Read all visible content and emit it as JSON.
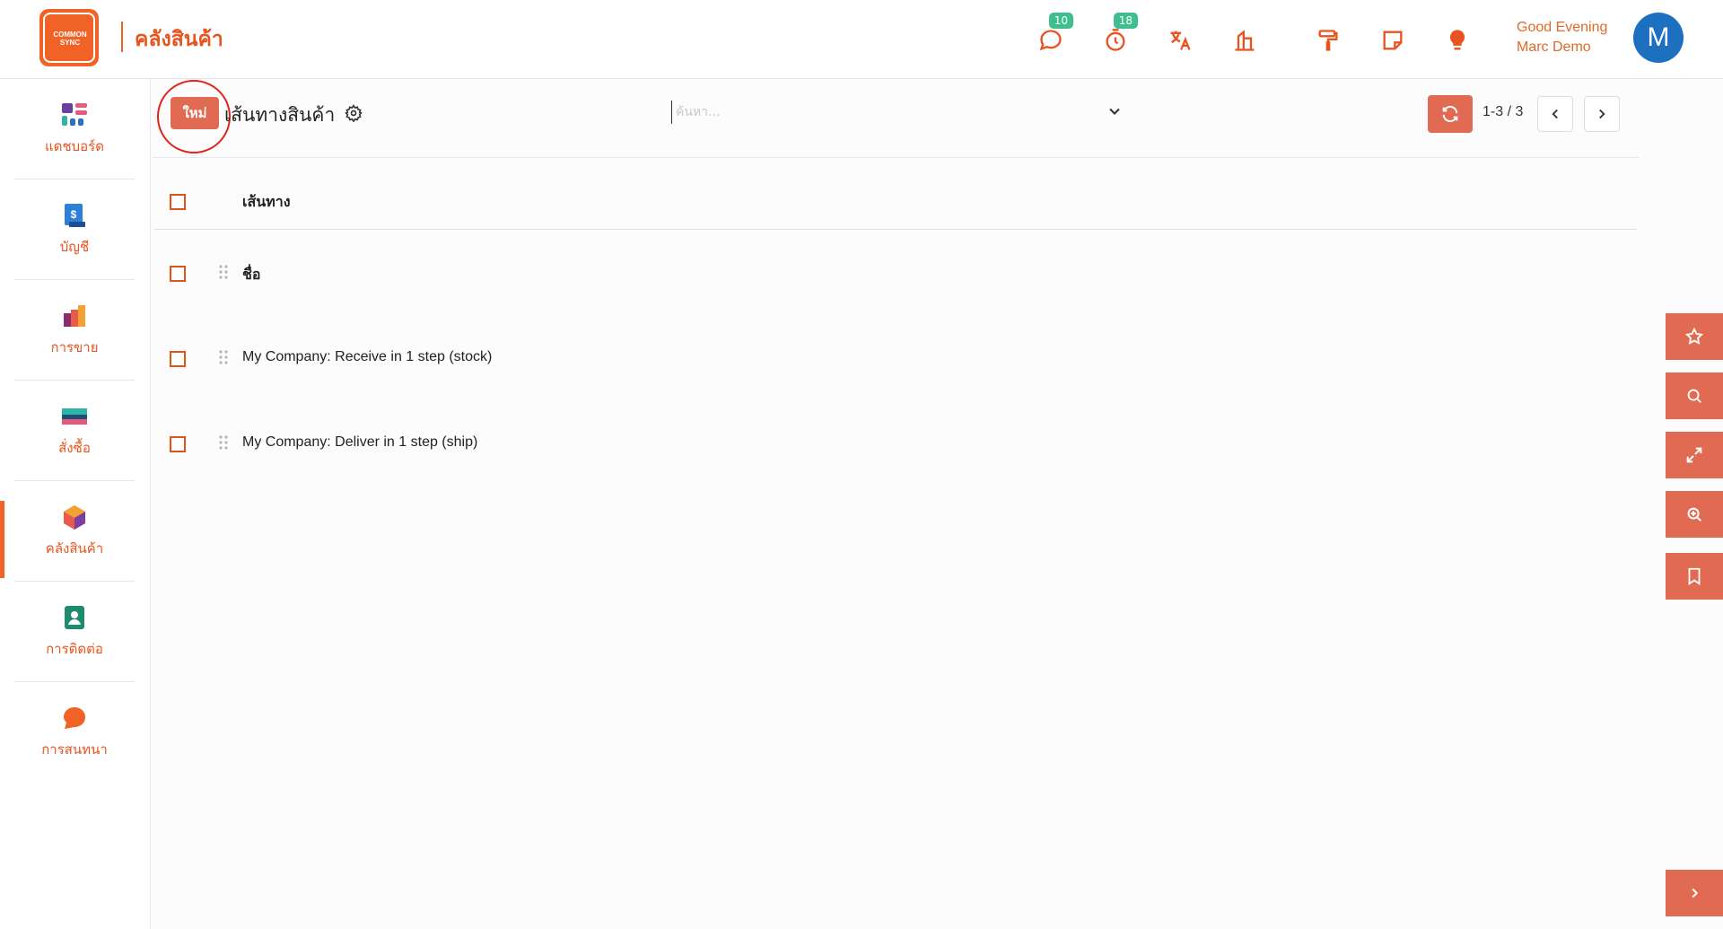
{
  "app": {
    "brand_logo_text": "COMMON SYNC",
    "module_title": "คลังสินค้า"
  },
  "topbar": {
    "icons": [
      {
        "name": "chat-icon",
        "badge": "10"
      },
      {
        "name": "timer-icon",
        "badge": "18"
      },
      {
        "name": "translate-icon"
      },
      {
        "name": "company-icon"
      },
      {
        "name": "paint-roller-icon"
      },
      {
        "name": "note-icon"
      },
      {
        "name": "lightbulb-icon"
      }
    ],
    "greeting": "Good Evening",
    "user_name": "Marc Demo",
    "avatar_initial": "M"
  },
  "sidebar": {
    "items": [
      {
        "label": "แดชบอร์ด",
        "icon": "dashboard-icon"
      },
      {
        "label": "บัญชี",
        "icon": "accounting-icon"
      },
      {
        "label": "การขาย",
        "icon": "sales-icon"
      },
      {
        "label": "สั่งซื้อ",
        "icon": "purchase-icon"
      },
      {
        "label": "คลังสินค้า",
        "icon": "inventory-icon",
        "active": true
      },
      {
        "label": "การติดต่อ",
        "icon": "contacts-icon"
      },
      {
        "label": "การสนทนา",
        "icon": "discuss-icon"
      }
    ],
    "accent_color": "#f06225"
  },
  "control_panel": {
    "new_button": "ใหม่",
    "title": "เส้นทางสินค้า",
    "search_placeholder": "ค้นหา...",
    "pager_value": "1-3 / 3"
  },
  "table": {
    "header": "เส้นทาง",
    "rows": [
      {
        "name": "ชื่อ",
        "bold": true
      },
      {
        "name": "My Company: Receive in 1 step (stock)"
      },
      {
        "name": "My Company: Deliver in 1 step (ship)"
      }
    ]
  },
  "float_buttons": [
    "star-icon",
    "search-icon",
    "expand-icon",
    "zoom-in-icon",
    "bookmark-icon"
  ],
  "colors": {
    "accent": "#e06a52",
    "brand": "#f06225",
    "badge": "#3fbf8f",
    "avatar": "#1d6fc0"
  }
}
